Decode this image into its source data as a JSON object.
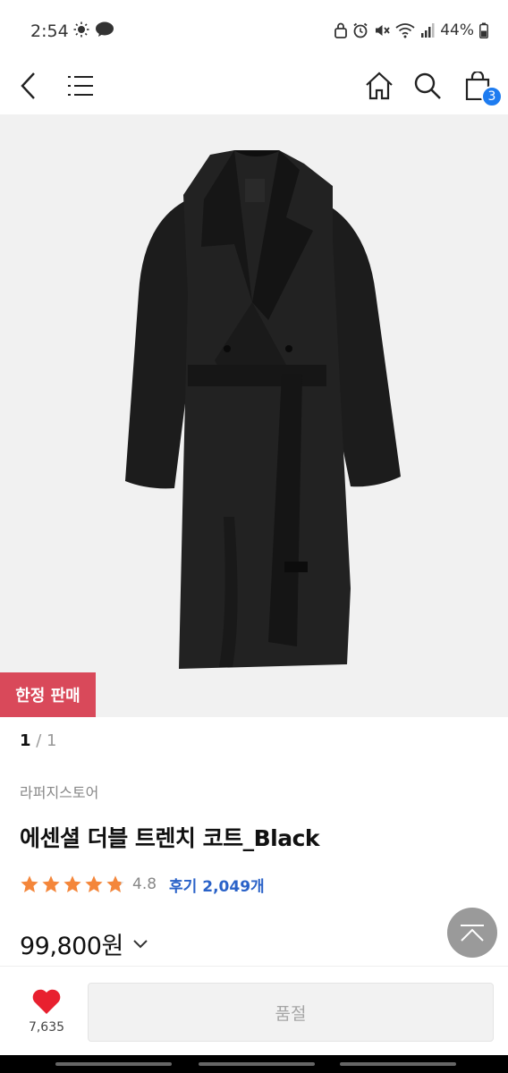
{
  "status_bar": {
    "time": "2:54",
    "battery": "44%"
  },
  "nav": {
    "cart_count": "3"
  },
  "product": {
    "badge": "한정 판매",
    "pager_current": "1",
    "pager_sep": " / ",
    "pager_total": "1",
    "brand": "라퍼지스토어",
    "title": "에센셜 더블 트렌치 코트_Black",
    "rating": "4.8",
    "rating_fraction": 0.96,
    "review_label": "후기 2,049개",
    "price": "99,800원"
  },
  "bottom_bar": {
    "like_count": "7,635",
    "soldout_label": "품절"
  },
  "colors": {
    "badge_bg": "#d9495a",
    "cart_badge": "#1e7cf0",
    "star": "#f4863a",
    "review_link": "#2a62c8",
    "heart": "#e8202f"
  }
}
